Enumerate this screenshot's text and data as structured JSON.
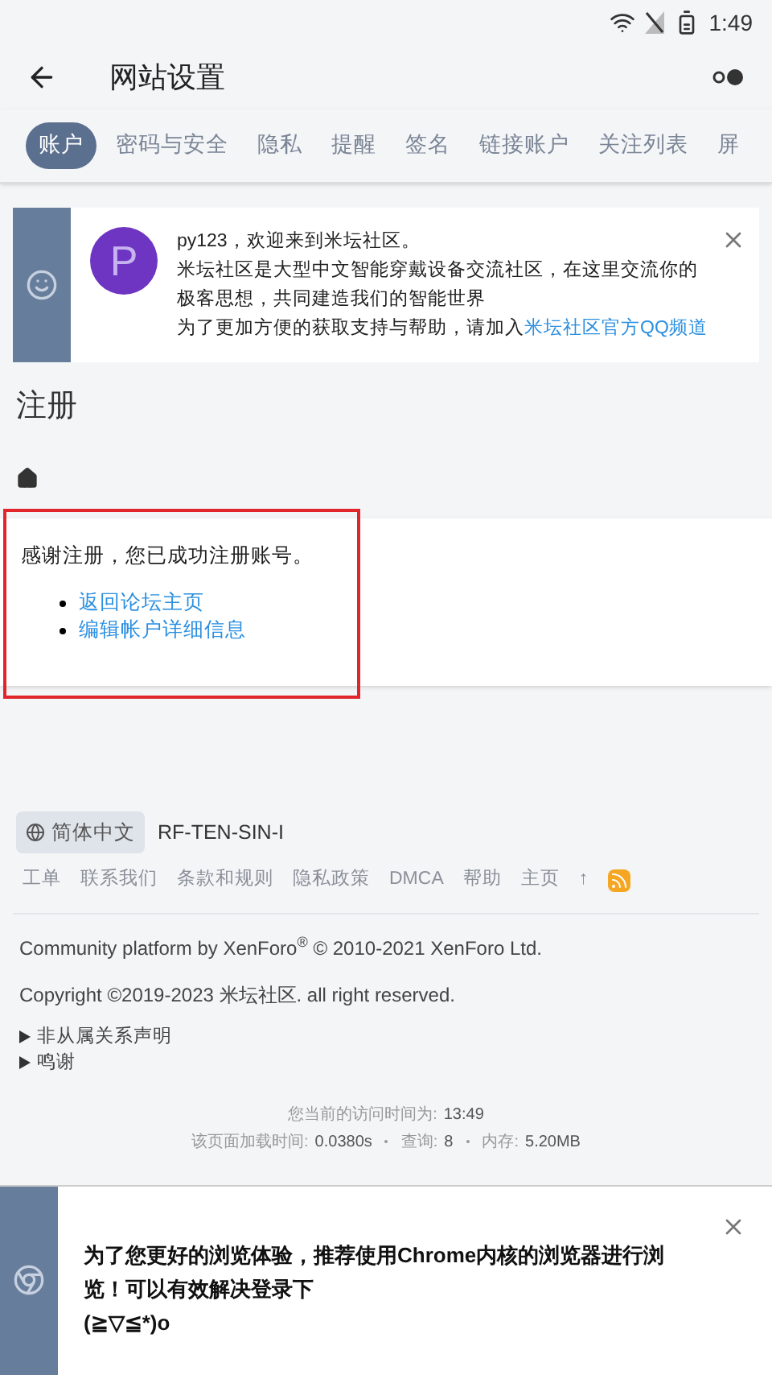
{
  "status_bar": {
    "time": "1:49"
  },
  "app_bar": {
    "title": "网站设置"
  },
  "tabs": [
    {
      "label": "账户",
      "selected": true
    },
    {
      "label": "密码与安全",
      "selected": false
    },
    {
      "label": "隐私",
      "selected": false
    },
    {
      "label": "提醒",
      "selected": false
    },
    {
      "label": "签名",
      "selected": false
    },
    {
      "label": "链接账户",
      "selected": false
    },
    {
      "label": "关注列表",
      "selected": false
    },
    {
      "label": "屏",
      "selected": false
    }
  ],
  "welcome_notice": {
    "avatar_letter": "P",
    "lines": [
      "py123，欢迎来到米坛社区。",
      "米坛社区是大型中文智能穿戴设备交流社区，在这里交流你的极客思想，共同建造我们的智能世界"
    ],
    "join_text": "为了更加方便的获取支持与帮助，请加入",
    "join_link": "米坛社区官方QQ频道"
  },
  "page_title": "注册",
  "message": {
    "text": "感谢注册，您已成功注册账号。",
    "links": [
      "返回论坛主页",
      "编辑帐户详细信息"
    ]
  },
  "footer": {
    "language": "简体中文",
    "style": "RF-TEN-SIN-I",
    "links": [
      "工单",
      "联系我们",
      "条款和规则",
      "隐私政策",
      "DMCA",
      "帮助",
      "主页",
      "↑"
    ],
    "platform": "Community platform by XenForo$^{®}$ © 2010-2021 XenForo Ltd.",
    "copyright": "Copyright ©2019-2023 米坛社区. all right reserved.",
    "disclosures": [
      "非从属关系声明",
      "鸣谢"
    ],
    "visit_label": "您当前的访问时间为:",
    "visit_time": "13:49",
    "stats": [
      {
        "label": "该页面加载时间:",
        "value": "0.0380s"
      },
      {
        "label": "查询:",
        "value": "8"
      },
      {
        "label": "内存:",
        "value": "5.20MB"
      }
    ]
  },
  "browser_notice": {
    "lines": [
      "为了您更好的浏览体验，推荐使用Chrome内核的浏览器进行浏览！可以有效解决登录下",
      "(≧▽≦*)o"
    ]
  }
}
